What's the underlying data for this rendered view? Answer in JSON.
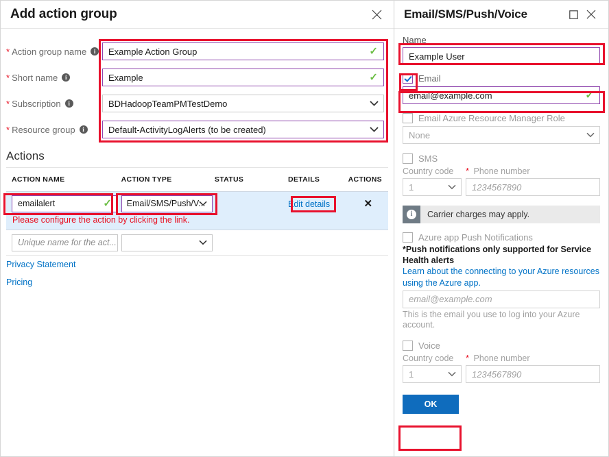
{
  "left_blade": {
    "title": "Add action group",
    "close_icon": "close-icon",
    "fields": [
      {
        "label": "Action group name",
        "required": "*",
        "value": "Example Action Group",
        "type": "text",
        "valid": "✓",
        "border": "purple"
      },
      {
        "label": "Short name",
        "required": "*",
        "value": "Example",
        "type": "text",
        "valid": "✓",
        "border": "purple"
      },
      {
        "label": "Subscription",
        "required": "*",
        "value": "BDHadoopTeamPMTestDemo",
        "type": "select",
        "border": "gray"
      },
      {
        "label": "Resource group",
        "required": "*",
        "value": "Default-ActivityLogAlerts (to be created)",
        "type": "select",
        "border": "purple"
      }
    ],
    "actions": {
      "heading": "Actions",
      "columns": [
        "ACTION NAME",
        "ACTION TYPE",
        "STATUS",
        "DETAILS",
        "ACTIONS"
      ],
      "rows": [
        {
          "name": "emailalert",
          "name_valid": "✓",
          "type": "Email/SMS/Push/V...",
          "status": "",
          "details_link": "Edit details",
          "remove_icon": "close-icon",
          "error": "Please configure the action by clicking the link."
        }
      ],
      "new_row": {
        "name_placeholder": "Unique name for the act...",
        "type_value": ""
      }
    },
    "footer_links": [
      "Privacy Statement",
      "Pricing"
    ]
  },
  "right_blade": {
    "title": "Email/SMS/Push/Voice",
    "maximize_icon": "maximize-icon",
    "close_icon": "close-icon",
    "name_label": "Name",
    "name_value": "Example User",
    "email": {
      "checkbox_label": "Email",
      "checked": true,
      "value": "email@example.com",
      "valid": "✓"
    },
    "arm_role": {
      "checkbox_label": "Email Azure Resource Manager Role",
      "checked": false,
      "select_value": "None"
    },
    "sms": {
      "checkbox_label": "SMS",
      "checked": false,
      "country_code_label": "Country code",
      "country_code_value": "1",
      "phone_required": "*",
      "phone_label": "Phone number",
      "phone_placeholder": "1234567890"
    },
    "carrier_note": {
      "icon": "info-icon",
      "text": "Carrier charges may apply."
    },
    "push": {
      "checkbox_label": "Azure app Push Notifications",
      "checked": false,
      "bold_note": "*Push notifications only supported for Service Health alerts",
      "learn_link": "Learn about the connecting to your Azure resources using the Azure app.",
      "email_placeholder": "email@example.com",
      "hint": "This is the email you use to log into your Azure account."
    },
    "voice": {
      "checkbox_label": "Voice",
      "checked": false,
      "country_code_label": "Country code",
      "country_code_value": "1",
      "phone_required": "*",
      "phone_label": "Phone number",
      "phone_placeholder": "1234567890"
    },
    "ok_label": "OK"
  },
  "colors": {
    "annotation_red": "#e8112d",
    "input_focus_purple": "#8e44ad",
    "link_blue": "#0072c6",
    "valid_green": "#6cbe45",
    "error_red": "#e81123",
    "row_highlight": "#dfeefc",
    "primary_button": "#0f6cbd"
  }
}
